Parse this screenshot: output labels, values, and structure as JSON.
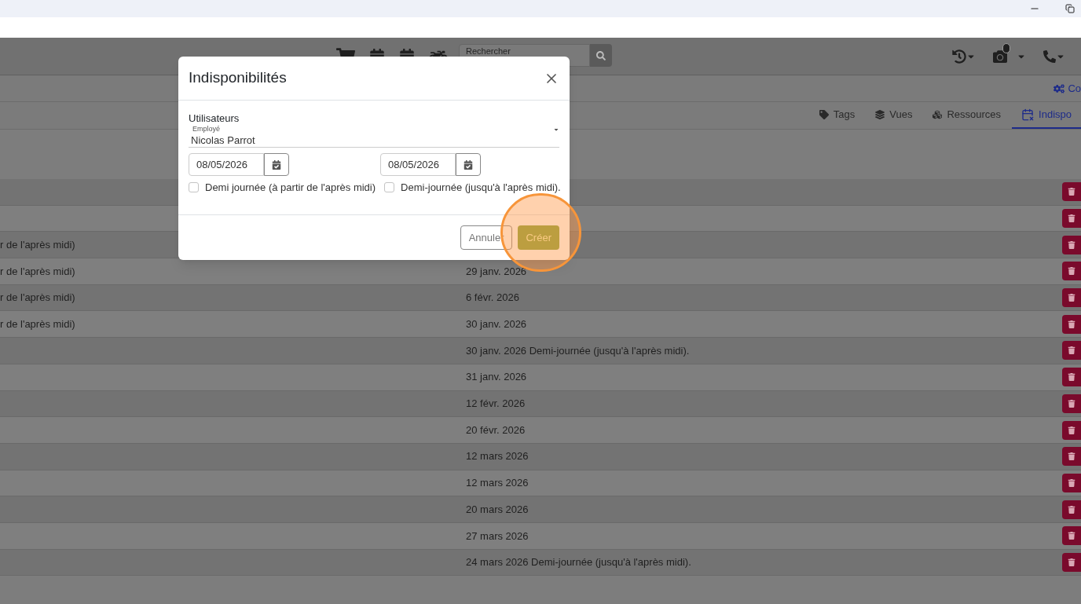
{
  "navbar": {
    "search": {
      "placeholder": "Rechercher"
    }
  },
  "tabs": [
    {
      "label": "Co",
      "selected": true
    }
  ],
  "subtabs": [
    {
      "label": "Tags",
      "selected": false
    },
    {
      "label": "Vues",
      "selected": false
    },
    {
      "label": "Ressources",
      "selected": false
    },
    {
      "label": "Indispo",
      "selected": true
    }
  ],
  "table": {
    "rows": [
      {},
      {},
      {
        "column_1": "r de l'après midi)"
      },
      {
        "column_1": "r de l'après midi)",
        "column_2": "29 janv. 2026"
      },
      {
        "column_1": "r de l'après midi)",
        "column_2": "6 févr. 2026"
      },
      {
        "column_1": "r de l'après midi)",
        "column_2": "30 janv. 2026"
      },
      {
        "column_2": "30 janv. 2026 Demi-journée (jusqu'à l'après midi)."
      },
      {
        "column_2": "31 janv. 2026"
      },
      {
        "column_2": "12 févr. 2026"
      },
      {
        "column_2": "20 févr. 2026"
      },
      {
        "column_2": "12 mars 2026"
      },
      {
        "column_2": "12 mars 2026"
      },
      {
        "column_2": "20 mars 2026"
      },
      {
        "column_2": "27 mars 2026"
      },
      {
        "column_2": "24 mars 2026 Demi-journée (jusqu'à l'après midi)."
      }
    ]
  },
  "dialog": {
    "title": "Indisponibilités",
    "users_label": "Utilisateurs",
    "select": {
      "label": "Employé",
      "value": "Nicolas Parrot"
    },
    "dates": [
      {
        "value": "08/05/2026"
      },
      {
        "value": "08/05/2026"
      }
    ],
    "checkboxes": [
      {
        "label": "Demi journée (à partir de l'après midi)",
        "checked": false
      },
      {
        "label": "Demi-journée (jusqu'à l'après midi).",
        "checked": false
      }
    ],
    "buttons": [
      {
        "label": "Annuler",
        "kind": "secondary"
      },
      {
        "label": "Créer",
        "kind": "primary"
      }
    ]
  }
}
